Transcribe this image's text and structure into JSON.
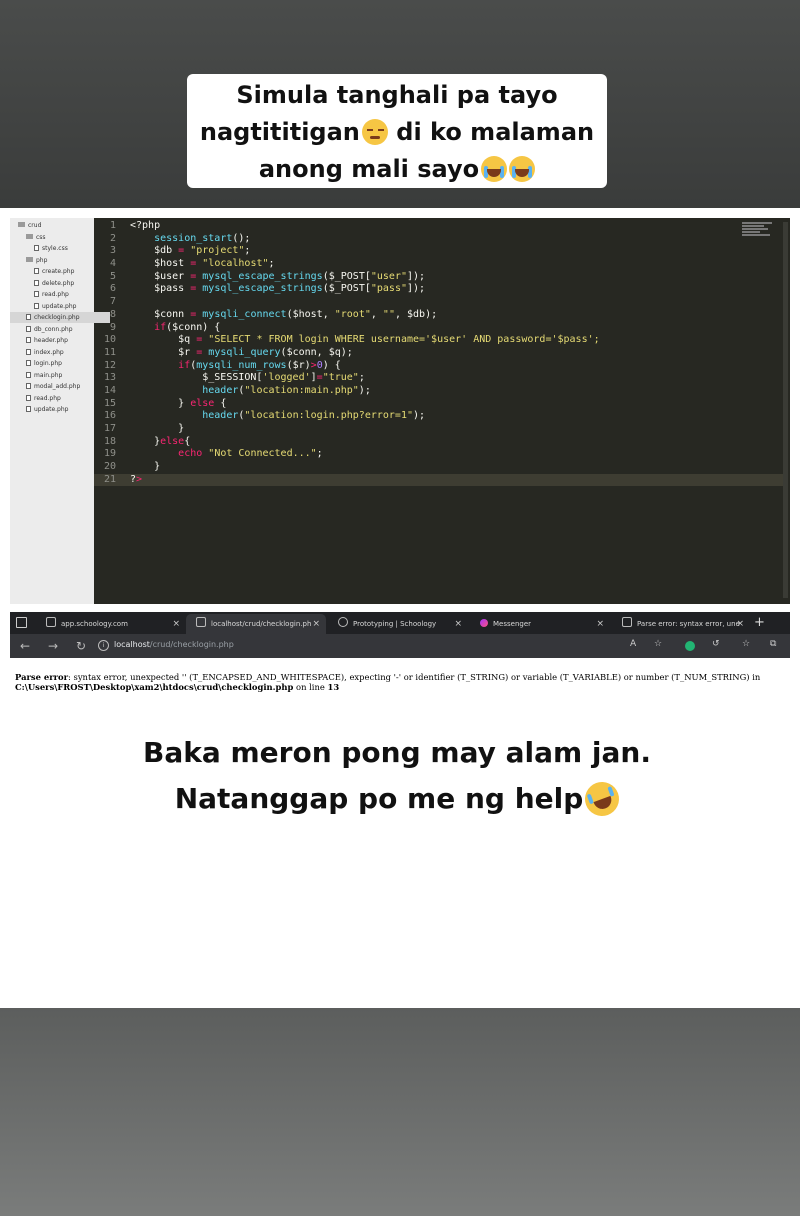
{
  "caption_top": {
    "line1": "Simula tanghali pa tayo",
    "line2": "nagtititigan",
    "line2b": " di ko malaman",
    "line3": "anong mali sayo"
  },
  "caption_bottom": {
    "line1": "Baka meron pong may alam jan.",
    "line2": "Natanggap po me ng help"
  },
  "file_tree": [
    {
      "label": "crud",
      "type": "folder",
      "depth": 0
    },
    {
      "label": "css",
      "type": "folder",
      "depth": 1
    },
    {
      "label": "style.css",
      "type": "file",
      "depth": 2
    },
    {
      "label": "php",
      "type": "folder",
      "depth": 1
    },
    {
      "label": "create.php",
      "type": "file",
      "depth": 2
    },
    {
      "label": "delete.php",
      "type": "file",
      "depth": 2
    },
    {
      "label": "read.php",
      "type": "file",
      "depth": 2
    },
    {
      "label": "update.php",
      "type": "file",
      "depth": 2
    },
    {
      "label": "checklogin.php",
      "type": "file",
      "depth": 1,
      "selected": true
    },
    {
      "label": "db_conn.php",
      "type": "file",
      "depth": 1
    },
    {
      "label": "header.php",
      "type": "file",
      "depth": 1
    },
    {
      "label": "index.php",
      "type": "file",
      "depth": 1
    },
    {
      "label": "login.php",
      "type": "file",
      "depth": 1
    },
    {
      "label": "main.php",
      "type": "file",
      "depth": 1
    },
    {
      "label": "modal_add.php",
      "type": "file",
      "depth": 1
    },
    {
      "label": "read.php",
      "type": "file",
      "depth": 1
    },
    {
      "label": "update.php",
      "type": "file",
      "depth": 1
    }
  ],
  "code_lines": [
    {
      "n": "1",
      "t": "<?php"
    },
    {
      "n": "2",
      "t": "    session_start();"
    },
    {
      "n": "3",
      "t": "    $db = \"project\";"
    },
    {
      "n": "4",
      "t": "    $host = \"localhost\";"
    },
    {
      "n": "5",
      "t": "    $user = mysql_escape_strings($_POST[\"user\"]);"
    },
    {
      "n": "6",
      "t": "    $pass = mysql_escape_strings($_POST[\"pass\"]);"
    },
    {
      "n": "7",
      "t": ""
    },
    {
      "n": "8",
      "t": "    $conn = mysqli_connect($host, \"root\", \"\", $db);"
    },
    {
      "n": "9",
      "t": "    if($conn) {"
    },
    {
      "n": "10",
      "t": "        $q = \"SELECT * FROM login WHERE username='$user' AND password='$pass';"
    },
    {
      "n": "11",
      "t": "        $r = mysqli_query($conn, $q);"
    },
    {
      "n": "12",
      "t": "        if(mysqli_num_rows($r)>0) {"
    },
    {
      "n": "13",
      "t": "            $_SESSION['logged']=\"true\";"
    },
    {
      "n": "14",
      "t": "            header(\"location:main.php\");"
    },
    {
      "n": "15",
      "t": "        } else {"
    },
    {
      "n": "16",
      "t": "            header(\"location:login.php?error=1\");"
    },
    {
      "n": "17",
      "t": "        }"
    },
    {
      "n": "18",
      "t": "    }else{"
    },
    {
      "n": "19",
      "t": "        echo \"Not Connected...\";"
    },
    {
      "n": "20",
      "t": "    }"
    },
    {
      "n": "21",
      "t": "?>",
      "current": true
    }
  ],
  "browser": {
    "tabs": [
      {
        "label": "app.schoology.com",
        "icon": "page-icon"
      },
      {
        "label": "localhost/crud/checklogin.ph",
        "icon": "page-icon",
        "active": true
      },
      {
        "label": "Prototyping | Schoology",
        "icon": "schoology-icon"
      },
      {
        "label": "Messenger",
        "icon": "messenger-icon"
      },
      {
        "label": "Parse error: syntax error, une",
        "icon": "search-icon"
      }
    ],
    "url_host": "localhost",
    "url_path": "/crud/checklogin.php"
  },
  "error": {
    "label": "Parse error",
    "message": ": syntax error, unexpected '' (T_ENCAPSED_AND_WHITESPACE), expecting '-' or identifier (T_STRING) or variable (T_VARIABLE) or number (T_NUM_STRING) in",
    "path": "C:\\Users\\FROST\\Desktop\\xam2\\htdocs\\crud\\checklogin.php",
    "on_line": " on line ",
    "line": "13"
  },
  "colors": {
    "editor_bg": "#272822",
    "keyword": "#f92672",
    "string": "#e6db74",
    "function": "#66d9ef"
  }
}
